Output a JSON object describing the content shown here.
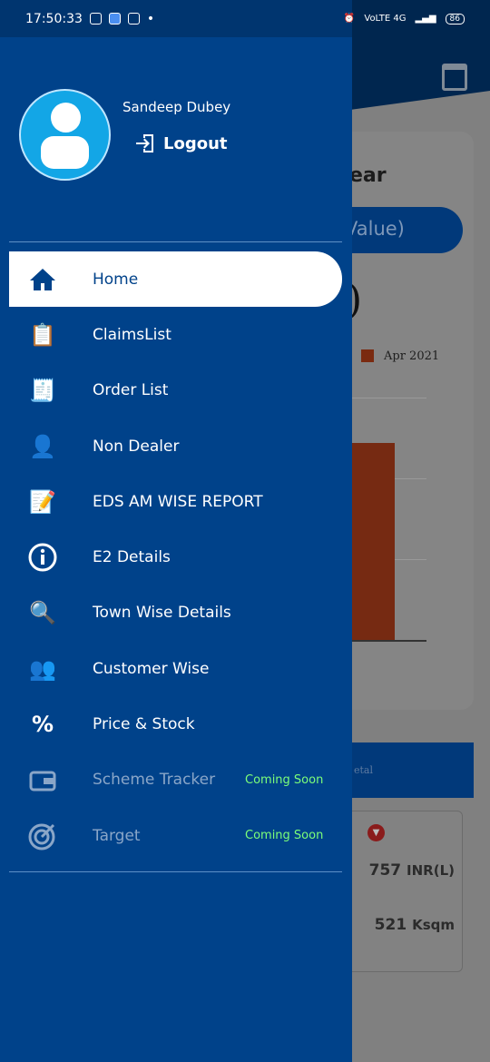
{
  "status_bar": {
    "time": "17:50:33",
    "battery": "86",
    "network": "VoLTE 4G"
  },
  "background": {
    "card_title_fragment": "ear",
    "pill_fragment": "Value)",
    "legend": "Apr 2021",
    "strip_fragment": "etal",
    "value1": "757",
    "unit1": "INR(L)",
    "value2": "521",
    "unit2": "Ksqm",
    "colors": {
      "bar": "#c8441b",
      "accent": "#0062cc"
    }
  },
  "drawer": {
    "user_name": "Sandeep Dubey",
    "logout_label": "Logout",
    "items": [
      {
        "label": "Home",
        "icon": "home-icon",
        "active": true
      },
      {
        "label": "ClaimsList",
        "icon": "clipboard-check-icon"
      },
      {
        "label": "Order List",
        "icon": "order-list-icon"
      },
      {
        "label": "Non Dealer",
        "icon": "person-icon"
      },
      {
        "label": "EDS AM WISE REPORT",
        "icon": "report-edit-icon"
      },
      {
        "label": "E2 Details",
        "icon": "info-icon"
      },
      {
        "label": "Town Wise Details",
        "icon": "town-search-icon"
      },
      {
        "label": "Customer Wise",
        "icon": "group-icon"
      },
      {
        "label": "Price & Stock",
        "icon": "percent-hand-icon"
      },
      {
        "label": "Scheme Tracker",
        "icon": "wallet-icon",
        "badge": "Coming Soon",
        "disabled": true
      },
      {
        "label": "Target",
        "icon": "target-icon",
        "badge": "Coming Soon",
        "disabled": true
      }
    ],
    "colors": {
      "drawer": "#00428a",
      "badge": "#7cff79"
    }
  }
}
